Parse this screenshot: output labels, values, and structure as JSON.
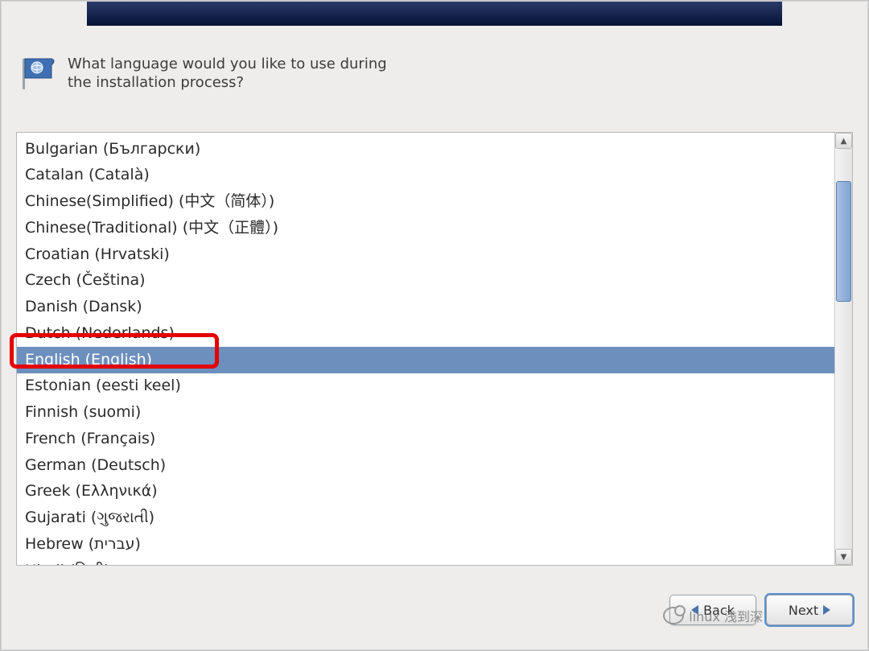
{
  "header": {
    "prompt": "What language would you like to use during the installation process?"
  },
  "languages": {
    "selected_index": 8,
    "items": [
      "Bulgarian (Български)",
      "Catalan (Català)",
      "Chinese(Simplified) (中文（简体）)",
      "Chinese(Traditional) (中文（正體）)",
      "Croatian (Hrvatski)",
      "Czech (Čeština)",
      "Danish (Dansk)",
      "Dutch (Nederlands)",
      "English (English)",
      "Estonian (eesti keel)",
      "Finnish (suomi)",
      "French (Français)",
      "German (Deutsch)",
      "Greek (Ελληνικά)",
      "Gujarati (ગુજરાતી)",
      "Hebrew (עברית)",
      "Hindi (हिन्दी)"
    ]
  },
  "footer": {
    "back_label": "Back",
    "next_label": "Next"
  },
  "watermark": {
    "text": "linux 浅到深"
  }
}
